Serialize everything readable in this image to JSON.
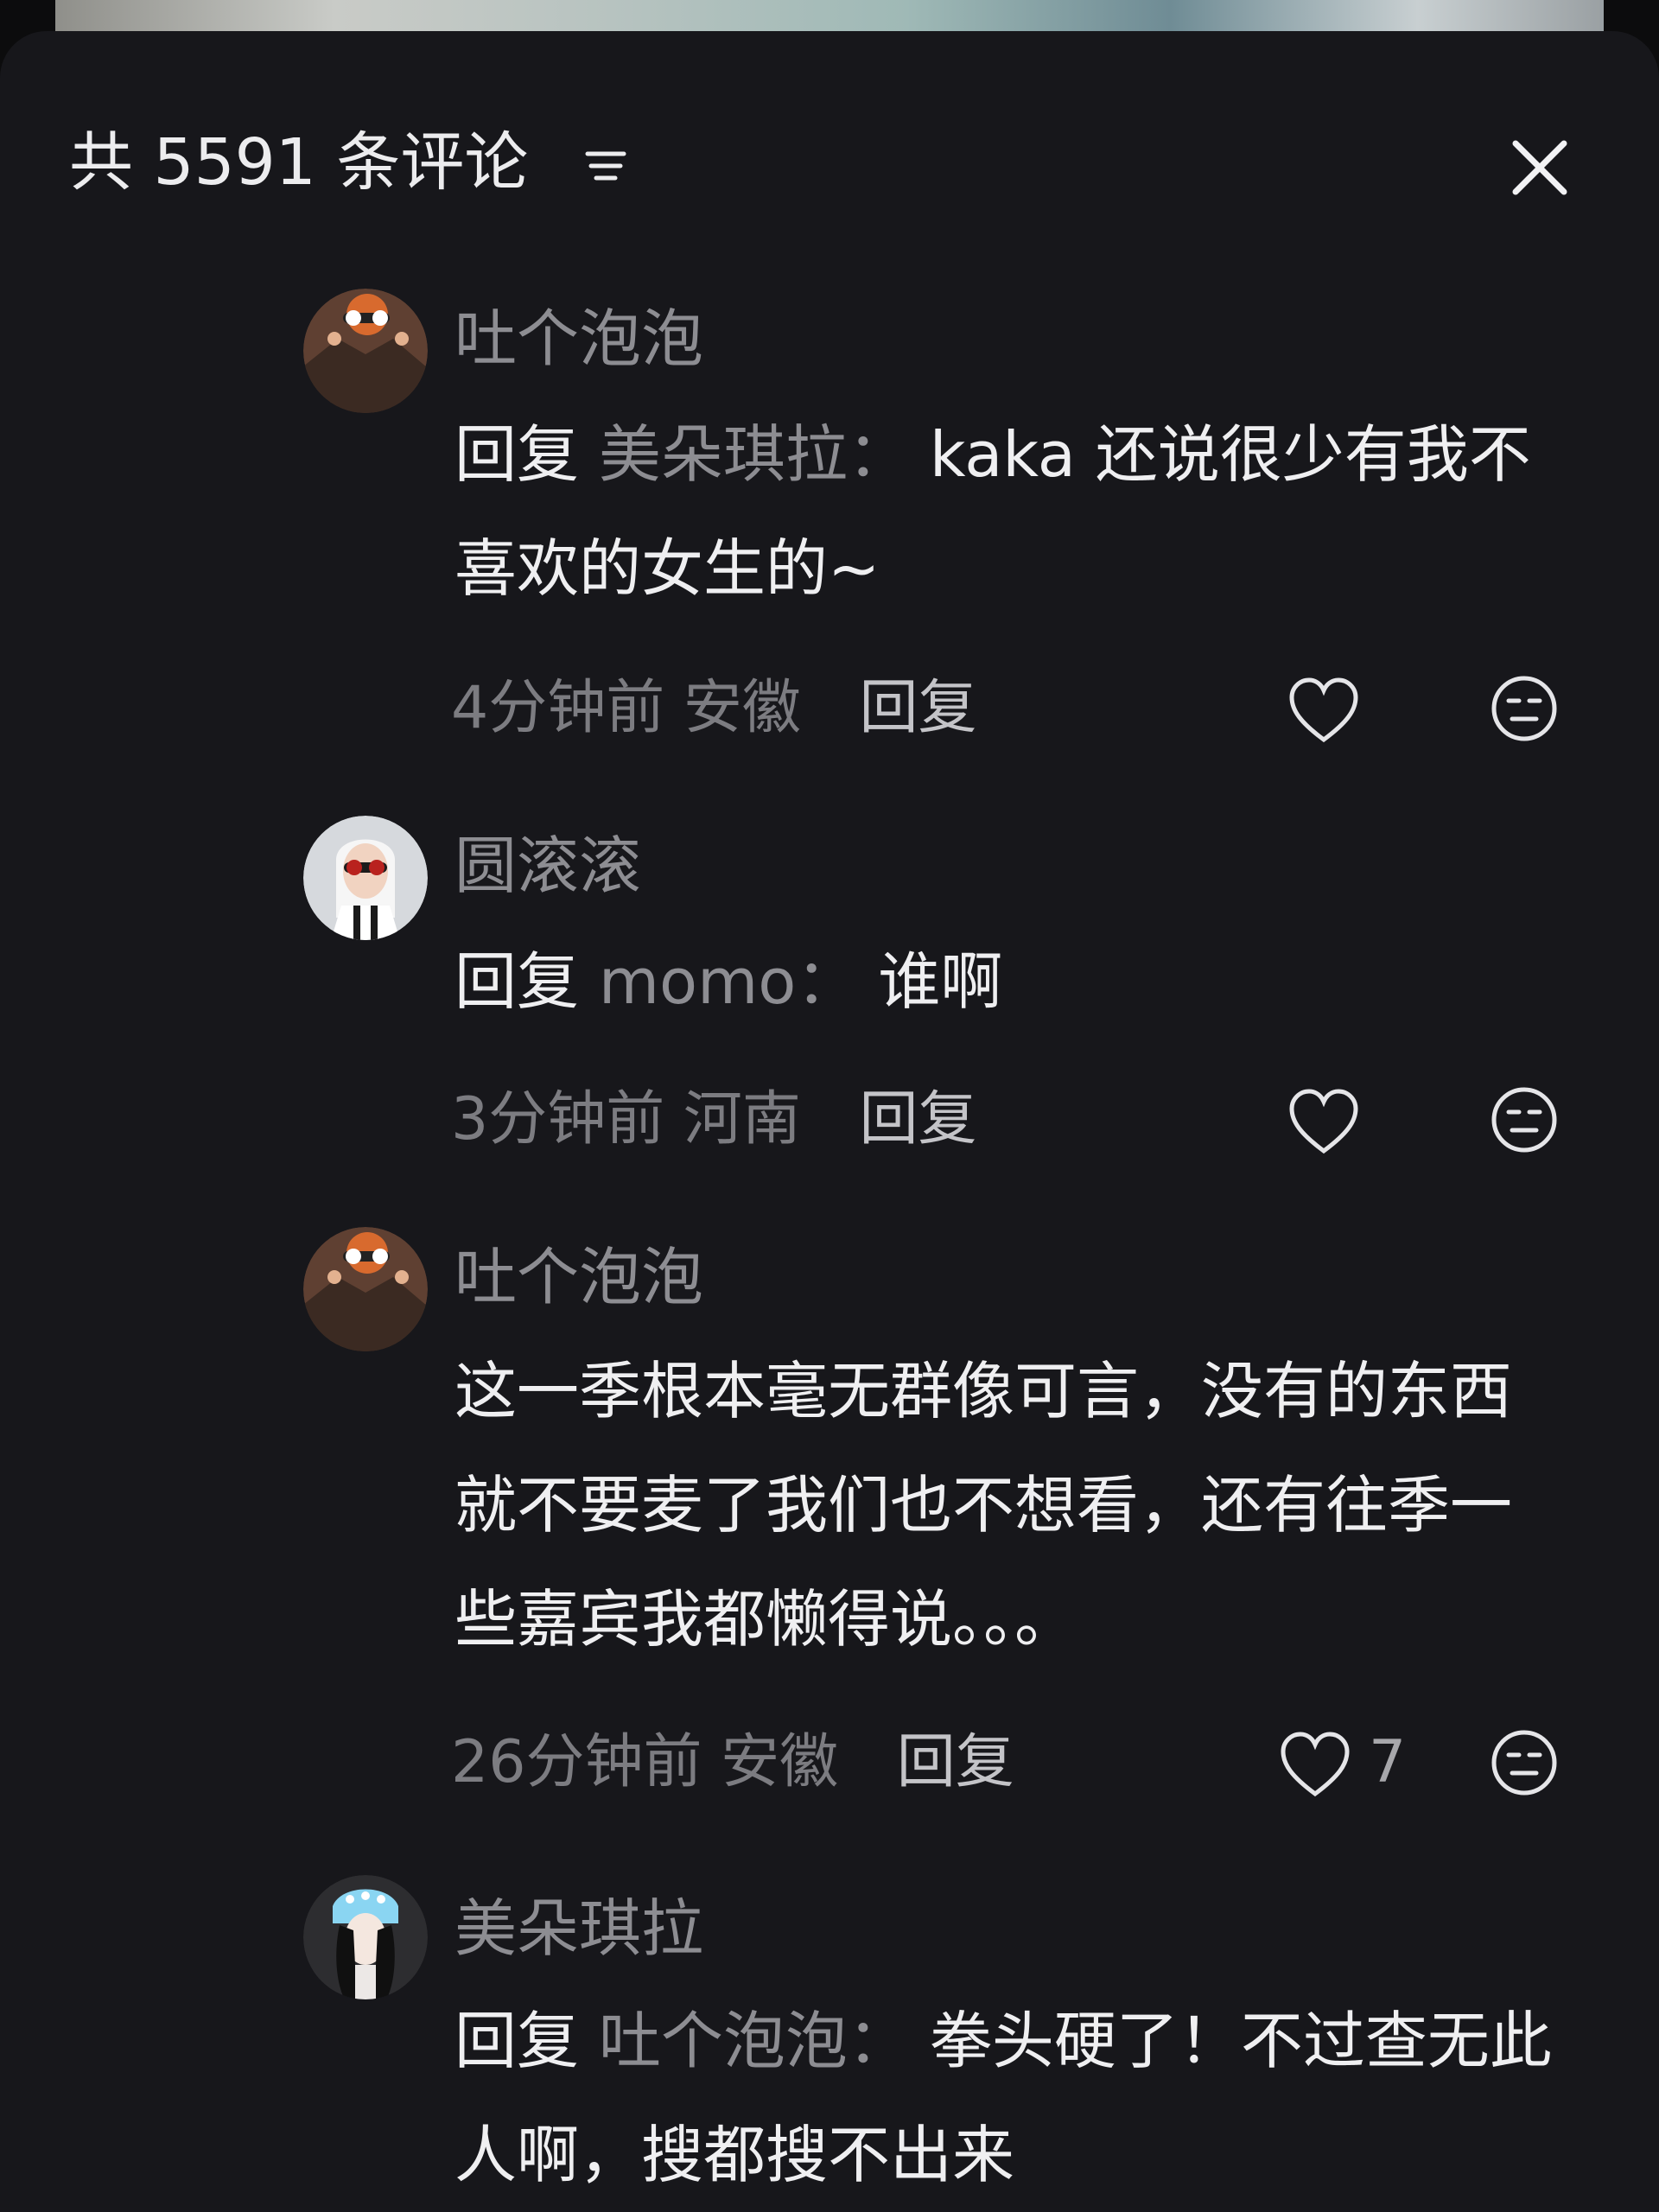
{
  "header": {
    "title": "共 5591 条评论",
    "sort_icon": "sort-filter-icon",
    "close_icon": "close-icon"
  },
  "comments": [
    {
      "username": "吐个泡泡",
      "reply_prefix": "回复",
      "reply_target": "美朵琪拉：",
      "text": "kaka 还说很少有我不喜欢的女生的~",
      "time": "4分钟前",
      "location": "安徽",
      "reply_label": "回复",
      "likes": "",
      "avatar_colors": [
        "#5f4032",
        "#d86a2e",
        "#2d2422"
      ]
    },
    {
      "username": "圆滚滚",
      "reply_prefix": "回复",
      "reply_target": "momo：",
      "text": "谁啊",
      "time": "3分钟前",
      "location": "河南",
      "reply_label": "回复",
      "likes": "",
      "avatar_colors": [
        "#d6d9dd",
        "#ffffff",
        "#1a1a1a"
      ]
    },
    {
      "username": "吐个泡泡",
      "reply_prefix": "",
      "reply_target": "",
      "text": "这一季根本毫无群像可言，没有的东西就不要麦了我们也不想看，还有往季一些嘉宾我都懒得说。。。",
      "time": "26分钟前",
      "location": "安徽",
      "reply_label": "回复",
      "likes": "7",
      "avatar_colors": [
        "#5f4032",
        "#d86a2e",
        "#2d2422"
      ]
    },
    {
      "username": "美朵琪拉",
      "reply_prefix": "回复",
      "reply_target": "吐个泡泡：",
      "text": "拳头硬了！不过查无此人啊，搜都搜不出来",
      "time": "",
      "location": "",
      "reply_label": "",
      "likes": "",
      "avatar_colors": [
        "#2d2d30",
        "#8ad5f2",
        "#f1f1f1"
      ]
    }
  ],
  "icons": {
    "like": "heart-outline-icon",
    "dislike": "neutral-face-icon"
  }
}
